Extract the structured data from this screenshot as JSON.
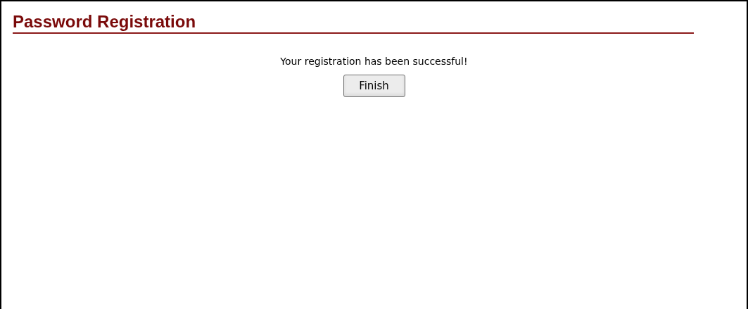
{
  "title": "Password Registration",
  "message": "Your registration has been successful!",
  "buttons": [
    "Finish"
  ]
}
